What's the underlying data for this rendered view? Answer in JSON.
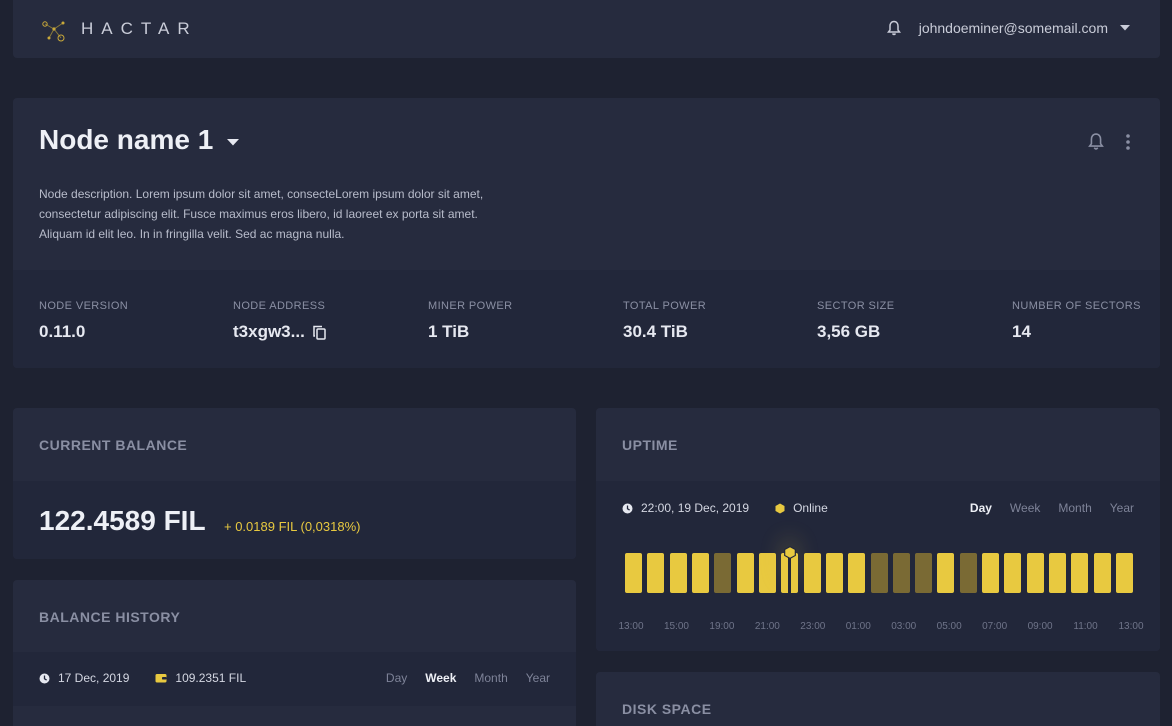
{
  "header": {
    "brand": "HACTAR",
    "user_email": "johndoeminer@somemail.com",
    "icons": [
      "logo-icon",
      "bell-icon",
      "chevron-down-icon"
    ]
  },
  "node": {
    "name": "Node name 1",
    "description": "Node description. Lorem ipsum dolor sit amet, consecteLorem ipsum dolor sit amet, consectetur adipiscing elit. Fusce maximus eros libero, id laoreet ex porta sit amet. Aliquam id elit leo. In in fringilla velit. Sed ac magna nulla.",
    "stats": [
      {
        "label": "NODE VERSION",
        "value": "0.11.0"
      },
      {
        "label": "NODE ADDRESS",
        "value": "t3xgw3..."
      },
      {
        "label": "MINER POWER",
        "value": "1 TiB"
      },
      {
        "label": "TOTAL POWER",
        "value": "30.4 TiB"
      },
      {
        "label": "SECTOR SIZE",
        "value": "3,56 GB"
      },
      {
        "label": "NUMBER OF SECTORS",
        "value": "14"
      }
    ]
  },
  "balance": {
    "title": "CURRENT BALANCE",
    "amount": "122.4589 FIL",
    "change": "+ 0.0189 FIL (0,0318%)"
  },
  "history": {
    "title": "BALANCE HISTORY",
    "date": "17 Dec, 2019",
    "wallet_value": "109.2351 FIL",
    "tabs": [
      "Day",
      "Week",
      "Month",
      "Year"
    ],
    "active_tab": "Week"
  },
  "uptime": {
    "title": "UPTIME",
    "timestamp": "22:00, 19 Dec, 2019",
    "status": "Online",
    "tabs": [
      "Day",
      "Week",
      "Month",
      "Year"
    ],
    "active_tab": "Day",
    "ticks": [
      "13:00",
      "15:00",
      "19:00",
      "21:00",
      "23:00",
      "01:00",
      "03:00",
      "05:00",
      "07:00",
      "09:00",
      "11:00",
      "13:00"
    ],
    "slots": [
      1,
      1,
      1,
      1,
      0,
      1,
      1,
      1,
      1,
      1,
      1,
      0,
      0,
      0,
      1,
      0,
      1,
      1,
      1,
      1,
      1,
      1,
      1
    ],
    "selected_slot": 7,
    "colors": {
      "online": "#e8c940",
      "offline": "#7a6a34"
    }
  },
  "disk": {
    "title": "DISK SPACE"
  }
}
